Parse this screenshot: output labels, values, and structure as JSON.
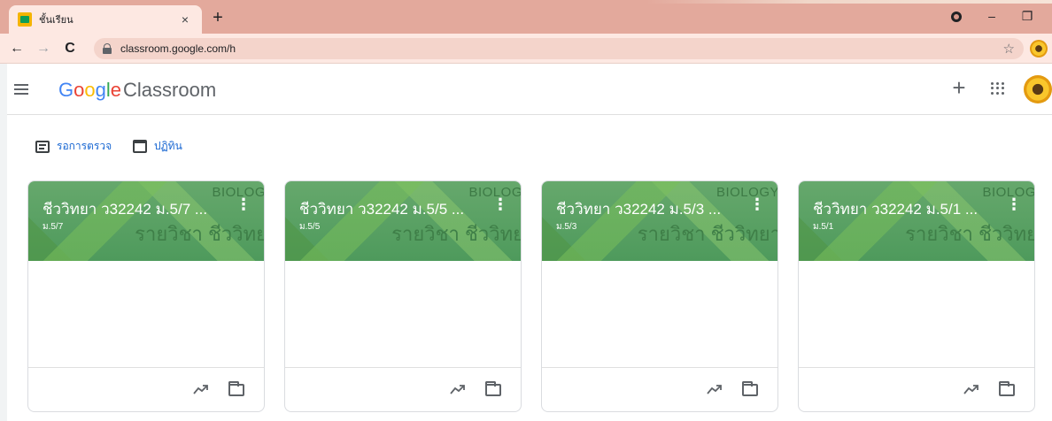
{
  "browser": {
    "tab_title": "ชั้นเรียน",
    "tab_close": "×",
    "new_tab": "+",
    "url": "classroom.google.com/h",
    "back": "←",
    "forward": "→",
    "reload": "C",
    "star": "☆",
    "minimize": "–",
    "restore": "❐"
  },
  "header": {
    "brand_letters": [
      "G",
      "o",
      "o",
      "g",
      "l",
      "e"
    ],
    "brand_colors": [
      "#4285f4",
      "#ea4335",
      "#fbbc05",
      "#4285f4",
      "#34a853",
      "#ea4335"
    ],
    "product": "Classroom",
    "add": "+"
  },
  "quick_links": {
    "todo": "รอการตรวจ",
    "calendar": "ปฏิทิน"
  },
  "cards": [
    {
      "title": "ชีววิทยา ว32242 ม.5/7 ...",
      "section": "ม.5/7",
      "banner_word": "BIOLOG",
      "banner_sub": "รายวิชา ชีววิทย"
    },
    {
      "title": "ชีววิทยา ว32242 ม.5/5 ...",
      "section": "ม.5/5",
      "banner_word": "BIOLOG",
      "banner_sub": "รายวิชา ชีววิทย"
    },
    {
      "title": "ชีววิทยา ว32242 ม.5/3 ...",
      "section": "ม.5/3",
      "banner_word": "BIOLOGY",
      "banner_sub": "รายวิชา ชีววิทยา"
    },
    {
      "title": "ชีววิทยา ว32242 ม.5/1 ...",
      "section": "ม.5/1",
      "banner_word": "BIOLOG",
      "banner_sub": "รายวิชา ชีววิทย"
    }
  ],
  "icons": {
    "menu": "hamburger-menu-icon",
    "apps": "apps-grid-icon",
    "more": "more-vert-icon",
    "trend": "trending-up-icon",
    "folder": "folder-icon"
  }
}
